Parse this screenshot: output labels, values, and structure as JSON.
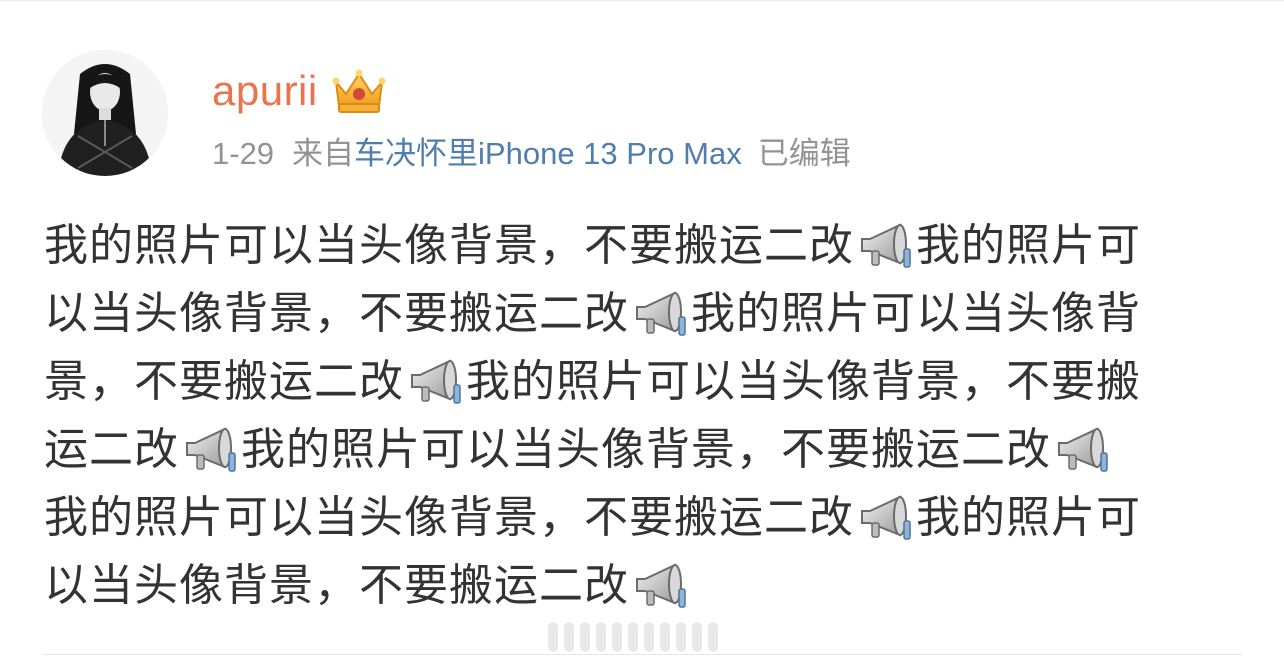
{
  "user": {
    "name": "apurii",
    "badge_icon": "crown-badge-icon",
    "name_color": "#eb7350"
  },
  "meta": {
    "date": "1-29",
    "from_label": "来自",
    "source": "车决怀里iPhone 13 Pro Max",
    "edited": "已编辑",
    "source_color": "#507daf"
  },
  "post": {
    "icon": "megaphone-icon",
    "lines": [
      [
        "我的照片可以当头像背景，不要搬运二改",
        "icon",
        "我的照片可"
      ],
      [
        "以当头像背景，不要搬运二改",
        "icon",
        "我的照片可以当头像背"
      ],
      [
        "景，不要搬运二改",
        "icon",
        "我的照片可以当头像背景，不要搬"
      ],
      [
        "运二改",
        "icon",
        "我的照片可以当头像背景，不要搬运二改",
        "icon"
      ],
      [
        "我的照片可以当头像背景，不要搬运二改",
        "icon",
        "我的照片可"
      ],
      [
        "以当头像背景，不要搬运二改",
        "icon"
      ]
    ]
  }
}
